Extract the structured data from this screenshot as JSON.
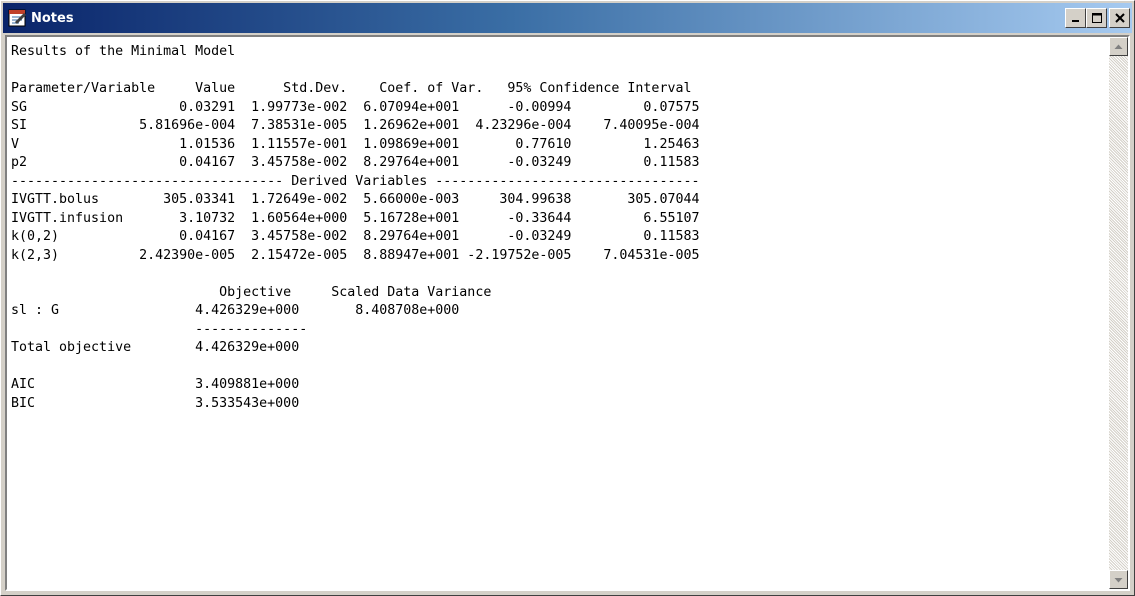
{
  "window": {
    "title": "Notes",
    "icon": "notes-icon",
    "controls": [
      "minimize-icon",
      "maximize-icon",
      "close-icon"
    ]
  },
  "notes": {
    "lines": [
      "Results of the Minimal Model",
      "",
      "Parameter/Variable     Value      Std.Dev.    Coef. of Var.   95% Confidence Interval",
      "SG                   0.03291  1.99773e-002  6.07094e+001      -0.00994         0.07575",
      "SI              5.81696e-004  7.38531e-005  1.26962e+001  4.23296e-004    7.40095e-004",
      "V                    1.01536  1.11557e-001  1.09869e+001       0.77610         1.25463",
      "p2                   0.04167  3.45758e-002  8.29764e+001      -0.03249         0.11583",
      "---------------------------------- Derived Variables ---------------------------------",
      "IVGTT.bolus        305.03341  1.72649e-002  5.66000e-003     304.99638       305.07044",
      "IVGTT.infusion       3.10732  1.60564e+000  5.16728e+001      -0.33644         6.55107",
      "k(0,2)               0.04167  3.45758e-002  8.29764e+001      -0.03249         0.11583",
      "k(2,3)          2.42390e-005  2.15472e-005  8.88947e+001 -2.19752e-005    7.04531e-005",
      "",
      "                          Objective     Scaled Data Variance",
      "sl : G                 4.426329e+000       8.408708e+000",
      "                       --------------",
      "Total objective        4.426329e+000",
      "",
      "AIC                    3.409881e+000",
      "BIC                    3.533543e+000"
    ]
  },
  "scrollbar": {
    "up_icon": "scroll-up-arrow-icon",
    "down_icon": "scroll-down-arrow-icon"
  }
}
